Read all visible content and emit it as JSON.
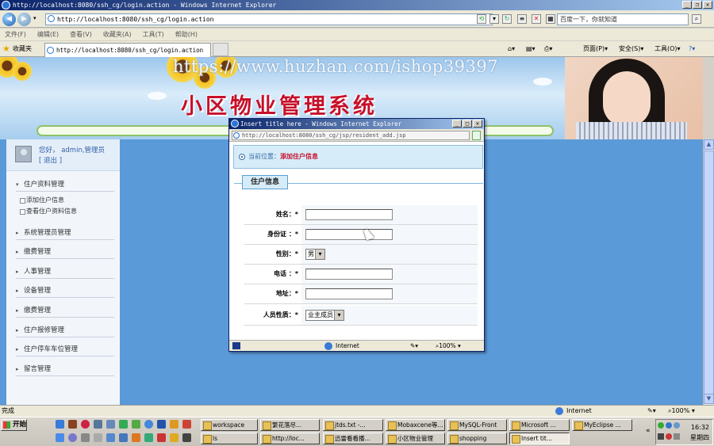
{
  "browser": {
    "window_title": "http://localhost:8080/ssh_cg/login.action - Windows Internet Explorer",
    "address": "http://localhost:8080/ssh_cg/login.action",
    "search_placeholder": "百度一下，你就知道",
    "menu": [
      "文件(F)",
      "编辑(E)",
      "查看(V)",
      "收藏夹(A)",
      "工具(T)",
      "帮助(H)"
    ],
    "favorites_label": "收藏夹",
    "tab_title": "http://localhost:8080/ssh_cg/login.action",
    "commands": [
      "页面(P)",
      "安全(S)",
      "工具(O)"
    ],
    "status_left": "完成",
    "status_zone": "Internet",
    "zoom": "100%"
  },
  "banner": {
    "watermark": "https://www.huzhan.com/ishop39397",
    "title": "小区物业管理系统"
  },
  "sidebar": {
    "greeting": "您好， admin,管理员",
    "logout": "[ 退出 ]",
    "items": [
      {
        "label": "住户资料管理",
        "open": true
      },
      {
        "label": "系统管理员管理"
      },
      {
        "label": "缴费管理"
      },
      {
        "label": "人事管理"
      },
      {
        "label": "设备管理"
      },
      {
        "label": "缴费管理"
      },
      {
        "label": "住户报修管理"
      },
      {
        "label": "住户停车车位管理"
      },
      {
        "label": "留言管理"
      }
    ],
    "sub_items": [
      "添加住户信息",
      "查看住户资料信息"
    ]
  },
  "popup": {
    "title": "Insert title here - Windows Internet Explorer",
    "address": "http://localhost:8080/ssh_cg/jsp/resident_add.jsp",
    "location_label": "当前位置：",
    "location_value": "添加住户信息",
    "legend": "住户信息",
    "fields": [
      {
        "label": "姓名：*",
        "type": "text",
        "value": ""
      },
      {
        "label": "身份证 ：*",
        "type": "text",
        "value": ""
      },
      {
        "label": "性别：*",
        "type": "select",
        "value": "男"
      },
      {
        "label": "电话 ：*",
        "type": "text",
        "value": ""
      },
      {
        "label": "地址：*",
        "type": "text",
        "value": ""
      },
      {
        "label": "人员性质：*",
        "type": "select",
        "value": "业主成员"
      }
    ],
    "status_zone": "Internet",
    "zoom": "100%"
  },
  "taskbar": {
    "start": "开始",
    "tasks_row1": [
      "workspace",
      "繁花落尽...",
      "jtds.txt -...",
      "Mobaxcene等...",
      "MySQL-Front",
      "Microsoft ...",
      "MyEclipse ..."
    ],
    "tasks_row2": [
      "ls",
      "http://loc...",
      "迅雷看看播...",
      "小区物业管理",
      "shopping",
      "Insert tit..."
    ],
    "time": "16:32",
    "weekday": "星期四"
  }
}
